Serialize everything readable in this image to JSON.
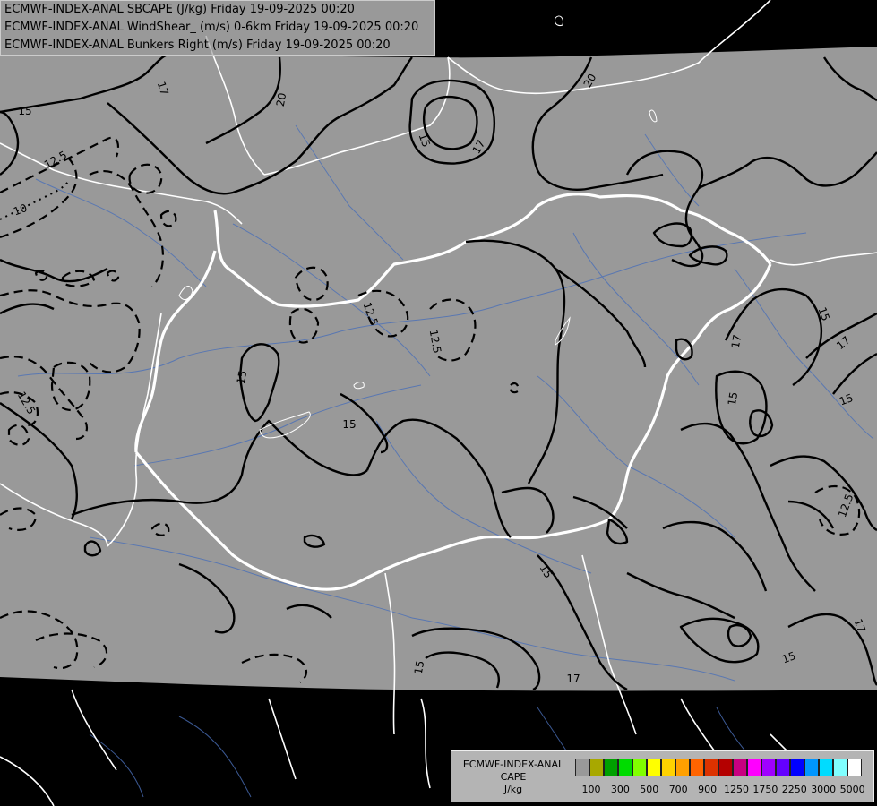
{
  "title": {
    "line1": "ECMWF-INDEX-ANAL SBCAPE (J/kg) Friday 19-09-2025 00:20",
    "line2": "ECMWF-INDEX-ANAL WindShear_ (m/s) 0-6km Friday 19-09-2025 00:20",
    "line3": "ECMWF-INDEX-ANAL Bunkers Right (m/s) Friday 19-09-2025 00:20"
  },
  "legend": {
    "line1": "ECMWF-INDEX-ANAL",
    "line2": "CAPE",
    "line3": "J/kg",
    "swatch_colors": [
      "#999999",
      "#a8a800",
      "#00a000",
      "#00dc00",
      "#80ff00",
      "#ffff00",
      "#ffd200",
      "#ffa000",
      "#ff6400",
      "#dc3200",
      "#b40000",
      "#c80080",
      "#ff00ff",
      "#a000ff",
      "#6400ff",
      "#0000ff",
      "#0096ff",
      "#00dcff",
      "#80ffff",
      "#ffffff"
    ],
    "ticks": [
      "100",
      "300",
      "500",
      "700",
      "900",
      "1250",
      "1750",
      "2250",
      "3000",
      "5000"
    ]
  },
  "map": {
    "background_color": "#999999",
    "outside_color": "#000000",
    "contour_labels": [
      {
        "text": "17"
      },
      {
        "text": "20"
      },
      {
        "text": "15"
      },
      {
        "text": "12.5"
      },
      {
        "text": "10"
      },
      {
        "text": "15"
      },
      {
        "text": "17"
      },
      {
        "text": "20"
      },
      {
        "text": "12.5"
      },
      {
        "text": "12.5"
      },
      {
        "text": "15"
      },
      {
        "text": "15"
      },
      {
        "text": "15"
      },
      {
        "text": "17"
      },
      {
        "text": "17"
      },
      {
        "text": "15"
      },
      {
        "text": "12.5"
      },
      {
        "text": "15"
      },
      {
        "text": "12.5"
      },
      {
        "text": "15"
      },
      {
        "text": "17"
      },
      {
        "text": "15"
      },
      {
        "text": "17"
      },
      {
        "text": "15"
      }
    ]
  }
}
